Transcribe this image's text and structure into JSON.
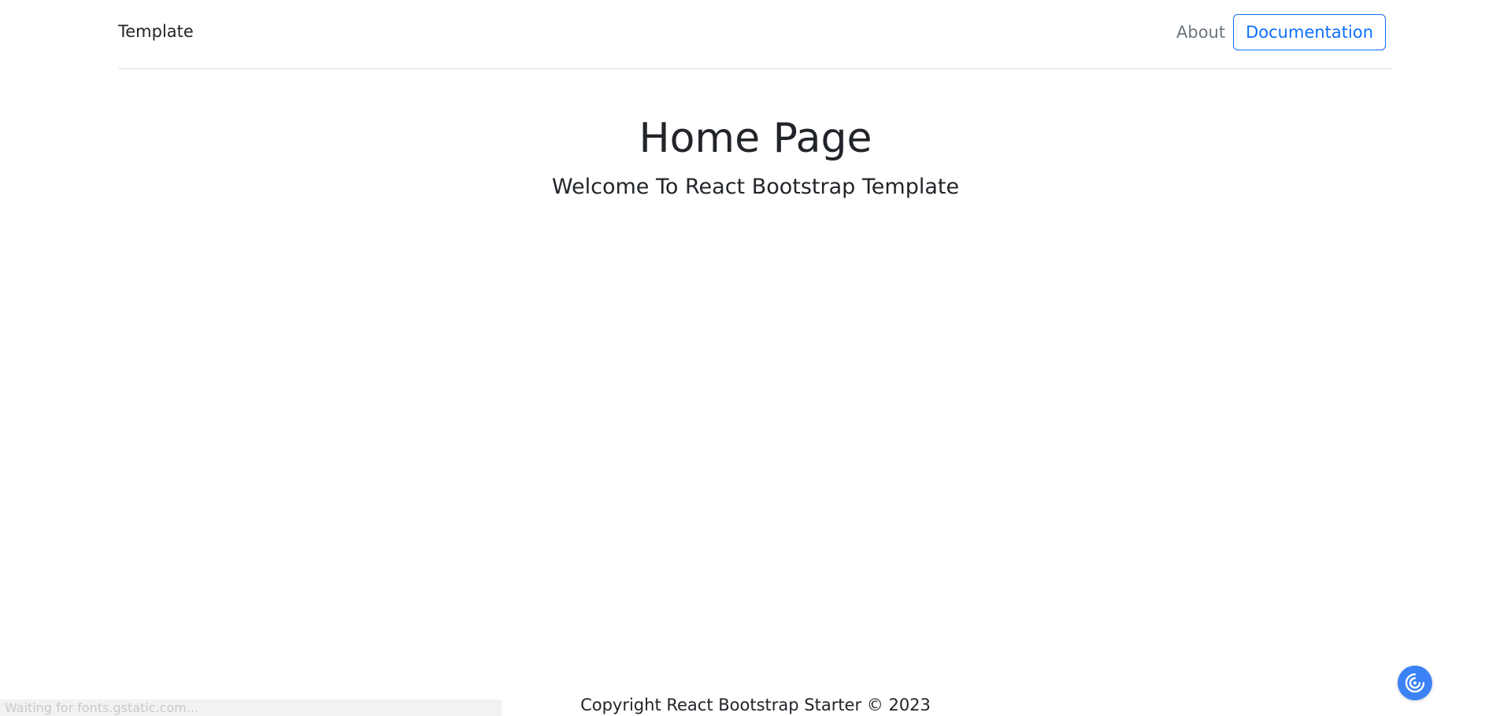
{
  "navbar": {
    "brand": "Template",
    "links": {
      "about": "About",
      "documentation": "Documentation"
    }
  },
  "hero": {
    "title": "Home Page",
    "subtitle": "Welcome To React Bootstrap Template"
  },
  "footer": {
    "copyright": "Copyright React Bootstrap Starter © 2023"
  },
  "status_bar": {
    "text": "Waiting for fonts.gstatic.com..."
  },
  "floating_button": {
    "icon": "swirl-icon"
  },
  "colors": {
    "primary": "#0d6efd",
    "muted": "#6c757d",
    "text": "#212529",
    "fab": "#3b82f6"
  }
}
